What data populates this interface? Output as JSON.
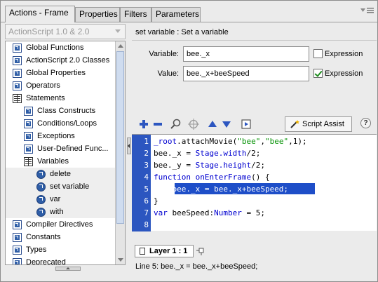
{
  "tabs": [
    {
      "label": "Actions - Frame",
      "active": true
    },
    {
      "label": "Properties",
      "active": false
    },
    {
      "label": "Filters",
      "active": false
    },
    {
      "label": "Parameters",
      "active": false
    }
  ],
  "version_select": {
    "value": "ActionScript 1.0 & 2.0"
  },
  "tree": {
    "items": [
      {
        "label": "Global Functions",
        "icon": "book-icon",
        "level": 0
      },
      {
        "label": "ActionScript 2.0 Classes",
        "icon": "book-icon",
        "level": 0
      },
      {
        "label": "Global Properties",
        "icon": "book-icon",
        "level": 0
      },
      {
        "label": "Operators",
        "icon": "book-icon",
        "level": 0
      },
      {
        "label": "Statements",
        "icon": "open-book-icon",
        "level": 0
      },
      {
        "label": "Class Constructs",
        "icon": "book-icon",
        "level": 1
      },
      {
        "label": "Conditions/Loops",
        "icon": "book-icon",
        "level": 1
      },
      {
        "label": "Exceptions",
        "icon": "book-icon",
        "level": 1
      },
      {
        "label": "User-Defined Func...",
        "icon": "book-icon",
        "level": 1
      },
      {
        "label": "Variables",
        "icon": "open-book-icon",
        "level": 1
      },
      {
        "label": "delete",
        "icon": "action-icon",
        "level": 2
      },
      {
        "label": "set variable",
        "icon": "action-icon",
        "level": 2
      },
      {
        "label": "var",
        "icon": "action-icon",
        "level": 2
      },
      {
        "label": "with",
        "icon": "action-icon",
        "level": 2
      },
      {
        "label": "Compiler Directives",
        "icon": "book-icon",
        "level": 0
      },
      {
        "label": "Constants",
        "icon": "book-icon",
        "level": 0
      },
      {
        "label": "Types",
        "icon": "book-icon",
        "level": 0
      },
      {
        "label": "Deprecated",
        "icon": "book-icon",
        "level": 0
      }
    ]
  },
  "action_title": "set variable : Set a variable",
  "fields": {
    "variable_label": "Variable:",
    "variable_value": "bee._x",
    "value_label": "Value:",
    "value_value": "bee._x+beeSpeed",
    "expression_label": "Expression",
    "variable_expression_checked": false,
    "value_expression_checked": true
  },
  "toolbar": {
    "script_assist_label": "Script Assist",
    "help_label": "?"
  },
  "code": {
    "line_numbers": [
      "1",
      "2",
      "3",
      "4",
      "5",
      "6",
      "7",
      "8"
    ],
    "lines": [
      "_root.attachMovie(\"bee\",\"bee\",1);",
      "bee._x = Stage.width/2;",
      "bee._y = Stage.height/2;",
      "function onEnterFrame() {",
      "    bee._x = bee._x+beeSpeed;",
      "}",
      "var beeSpeed:Number = 5;",
      ""
    ],
    "selected_line": 5
  },
  "layer_tab": {
    "label": "Layer 1 : 1"
  },
  "status_text": "Line 5: bee._x = bee._x+beeSpeed;",
  "colors": {
    "accent": "#2c56c0",
    "selection": "#1e4ec8",
    "keyword": "#0000d0",
    "string": "#009000"
  }
}
